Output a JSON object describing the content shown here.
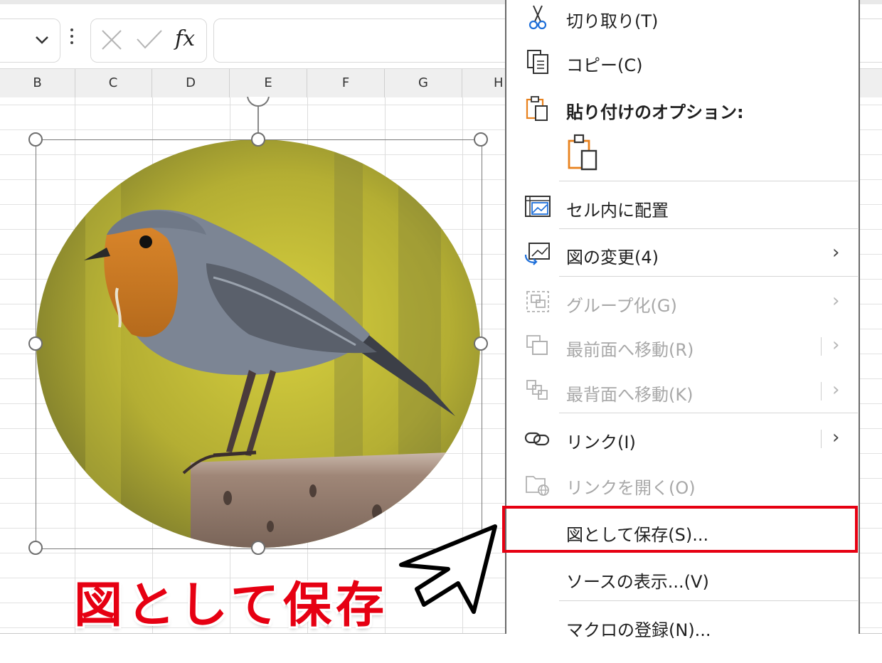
{
  "formula_bar": {
    "fx_label": "fx"
  },
  "columns": [
    "B",
    "C",
    "D",
    "E",
    "F",
    "G",
    "H"
  ],
  "context_menu": {
    "items": [
      {
        "label": "切り取り(T)",
        "icon": "scissors-icon",
        "disabled": false
      },
      {
        "label": "コピー(C)",
        "icon": "copy-icon",
        "disabled": false
      },
      {
        "label": "貼り付けのオプション:",
        "icon": "paste-icon",
        "disabled": false,
        "header": true
      },
      {
        "label": "セル内に配置",
        "icon": "place-in-cell-icon",
        "disabled": false
      },
      {
        "label": "図の変更(4)",
        "icon": "change-picture-icon",
        "disabled": false,
        "submenu": true
      },
      {
        "label": "グループ化(G)",
        "icon": "group-icon",
        "disabled": true,
        "submenu": true
      },
      {
        "label": "最前面へ移動(R)",
        "icon": "bring-to-front-icon",
        "disabled": true,
        "submenu": true
      },
      {
        "label": "最背面へ移動(K)",
        "icon": "send-to-back-icon",
        "disabled": true,
        "submenu": true
      },
      {
        "label": "リンク(I)",
        "icon": "link-icon",
        "disabled": false,
        "submenu": true
      },
      {
        "label": "リンクを開く(O)",
        "icon": "open-link-icon",
        "disabled": true
      },
      {
        "label": "図として保存(S)...",
        "icon": "",
        "disabled": false,
        "highlighted": true
      },
      {
        "label": "ソースの表示...(V)",
        "icon": "",
        "disabled": false
      },
      {
        "label": "マクロの登録(N)...",
        "icon": "",
        "disabled": false
      }
    ]
  },
  "annotation": {
    "caption": "図として保存",
    "highlight_color": "#e60012"
  },
  "colors": {
    "accent_orange": "#e8821e",
    "annotation_red": "#e60012"
  }
}
